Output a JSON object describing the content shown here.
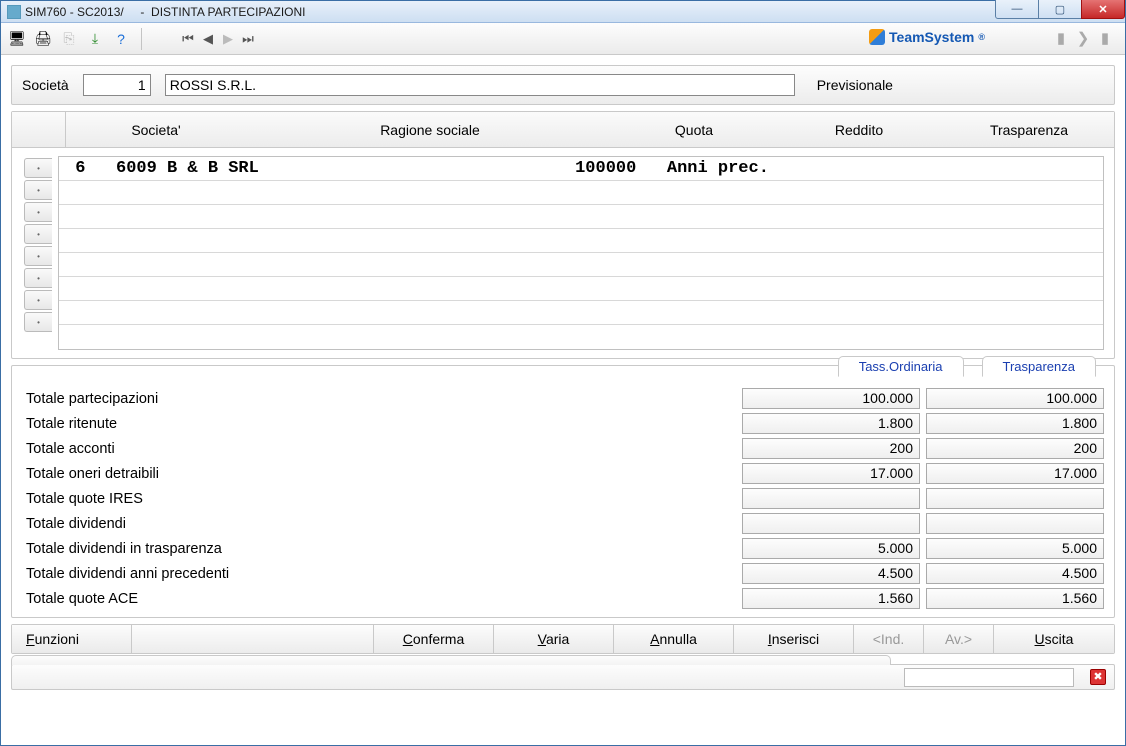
{
  "window": {
    "title": "SIM760 - SC2013/     -  DISTINTA PARTECIPAZIONI"
  },
  "brand": "TeamSystem",
  "header": {
    "societa_label": "Società",
    "societa_code": "1",
    "societa_name": "ROSSI S.R.L.",
    "previsionale_label": "Previsionale"
  },
  "grid": {
    "columns": {
      "societa": "Societa'",
      "ragione": "Ragione sociale",
      "quota": "Quota",
      "reddito": "Reddito",
      "trasparenza": "Trasparenza"
    },
    "rows": [
      " 6   6009 B & B SRL                               100000   Anni prec."
    ]
  },
  "totals": {
    "col_tabs": {
      "ordinaria": "Tass.Ordinaria",
      "trasparenza": "Trasparenza"
    },
    "rows": [
      {
        "label": "Totale partecipazioni",
        "ord": "100.000",
        "tra": "100.000"
      },
      {
        "label": "Totale ritenute",
        "ord": "1.800",
        "tra": "1.800"
      },
      {
        "label": "Totale acconti",
        "ord": "200",
        "tra": "200"
      },
      {
        "label": "Totale oneri detraibili",
        "ord": "17.000",
        "tra": "17.000"
      },
      {
        "label": "Totale quote IRES",
        "ord": "",
        "tra": ""
      },
      {
        "label": "Totale dividendi",
        "ord": "",
        "tra": ""
      },
      {
        "label": "Totale dividendi in trasparenza",
        "ord": "5.000",
        "tra": "5.000"
      },
      {
        "label": "Totale dividendi anni precedenti",
        "ord": "4.500",
        "tra": "4.500"
      },
      {
        "label": "Totale quote ACE",
        "ord": "1.560",
        "tra": "1.560"
      }
    ]
  },
  "footer": {
    "funzioni": "Funzioni",
    "conferma": "Conferma",
    "varia": "Varia",
    "annulla": "Annulla",
    "inserisci": "Inserisci",
    "ind": "<Ind.",
    "av": "Av.>",
    "uscita": "Uscita"
  }
}
